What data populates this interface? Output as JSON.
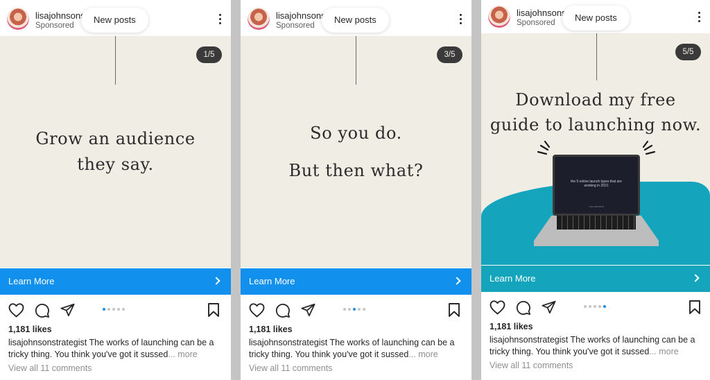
{
  "posts": [
    {
      "username": "lisajohnsonstrategist",
      "sponsored": "Sponsored",
      "new_posts": "New posts",
      "counter": "1/5",
      "slide_text": [
        "Grow an audience",
        "they say."
      ],
      "cta": "Learn More",
      "likes": "1,181 likes",
      "caption_user": "lisajohnsonstrategist",
      "caption_text": " The works of launching can be a tricky thing. You think you've got it sussed",
      "caption_more": "... more",
      "comments": "View all 11 comments",
      "carousel": {
        "active": 1,
        "total": 5
      },
      "cta_color": "#1191ed"
    },
    {
      "username": "lisajohnsonstrategist",
      "sponsored": "Sponsored",
      "new_posts": "New posts",
      "counter": "3/5",
      "slide_text": [
        "So you do.",
        "But then what?"
      ],
      "cta": "Learn More",
      "likes": "1,181 likes",
      "caption_user": "lisajohnsonstrategist",
      "caption_text": " The works of launching can be a tricky thing. You think you've got it sussed",
      "caption_more": "... more",
      "comments": "View all 11 comments",
      "carousel": {
        "active": 3,
        "total": 5
      },
      "cta_color": "#1191ed"
    },
    {
      "username": "lisajohnsonstrategist",
      "sponsored": "Sponsored",
      "new_posts": "New posts",
      "counter": "5/5",
      "slide_text": [
        "Download my free",
        "guide to launching now."
      ],
      "laptop_screen_text": "the 5 online launch types that are working in 2021",
      "laptop_small_text": "LISA JOHNSON",
      "cta": "Learn More",
      "likes": "1,181 likes",
      "caption_user": "lisajohnsonstrategist",
      "caption_text": " The works of launching can be a tricky thing. You think you've got it sussed",
      "caption_more": "... more",
      "comments": "View all 11 comments",
      "carousel": {
        "active": 5,
        "total": 5
      },
      "cta_color": "#14a5bc"
    }
  ],
  "icons": [
    "heart-icon",
    "comment-icon",
    "share-icon",
    "bookmark-icon",
    "more-options-icon",
    "chevron-right-icon"
  ],
  "colors": {
    "slide_background": "#f0ede4",
    "accent_blue": "#1191ed",
    "teal": "#14a5bc",
    "dot_active": "#1b8fe6"
  }
}
